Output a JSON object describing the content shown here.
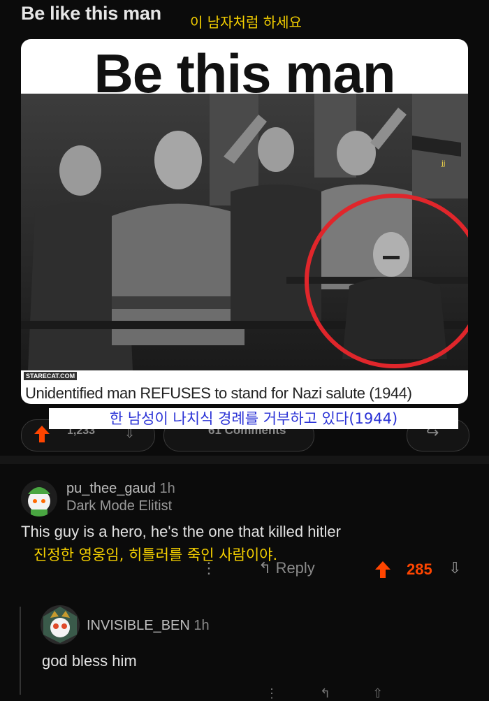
{
  "post": {
    "title": "Be like this man",
    "title_ko": "이 남자처럼 하세요"
  },
  "meme": {
    "heading": "Be this man",
    "watermark": "STARECAT.COM",
    "caption": "Unidentified man REFUSES to stand for Nazi salute (1944)",
    "caption_ko": "한 남성이 나치식 경례를 거부하고 있다(1944)",
    "photo_mark": "jj"
  },
  "actions": {
    "upvotes": "1,233",
    "comments": "61 Comments"
  },
  "comments": [
    {
      "username": "pu_thee_gaud",
      "time": "1h",
      "flair": "Dark Mode Elitist",
      "body": "This guy is a hero, he's the one that killed hitler",
      "body_ko": "진정한 영웅임, 히틀러를 죽인 사람이야.",
      "more": "⋮",
      "reply": "Reply",
      "score": "285"
    },
    {
      "username": "INVISIBLE_BEN",
      "time": "1h",
      "body": "god bless him"
    }
  ],
  "colors": {
    "background": "#0b0b0b",
    "accent": "#ff4500",
    "translation_yellow": "#f5d000",
    "translation_blue": "#2a32d6",
    "highlight_circle": "#e0262b"
  },
  "icons": [
    "upvote-arrow-icon",
    "downvote-arrow-icon",
    "comment-icon",
    "share-icon",
    "reply-icon",
    "more-icon"
  ]
}
